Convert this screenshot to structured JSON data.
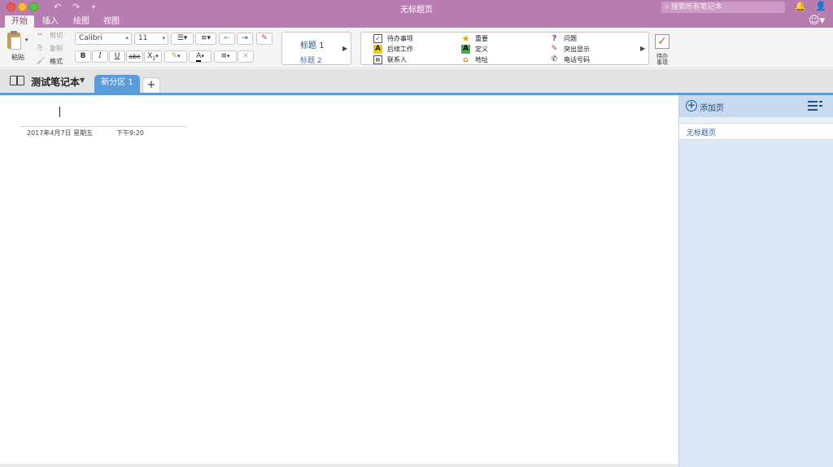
{
  "window": {
    "title": "无标题页",
    "search_placeholder": "搜索所有笔记本"
  },
  "menu_tabs": [
    "开始",
    "插入",
    "绘图",
    "视图"
  ],
  "ribbon": {
    "paste": "粘贴",
    "cut": "剪切",
    "copy": "复制",
    "format": "格式",
    "font_name": "Calibri",
    "font_size": "11",
    "bold": "B",
    "italic": "I",
    "underline": "U",
    "strike": "abc",
    "subscript": "X",
    "font_color_letter": "A",
    "styles": {
      "heading1": "标题 1",
      "heading2": "标题 2"
    },
    "tags": {
      "todo": "待办事项",
      "followup": "后续工作",
      "contact": "联系人",
      "important": "重要",
      "definition": "定义",
      "address": "地址",
      "question": "问题",
      "highlight": "突出显示",
      "phone": "电话号码"
    },
    "todo_button": "待办事项"
  },
  "notebook": {
    "name": "测试笔记本",
    "section": "新分区 1"
  },
  "page": {
    "date": "2017年4月7日 星期五",
    "time": "下午9:20"
  },
  "page_panel": {
    "add_page": "添加页",
    "pages": [
      "无标题页"
    ]
  }
}
